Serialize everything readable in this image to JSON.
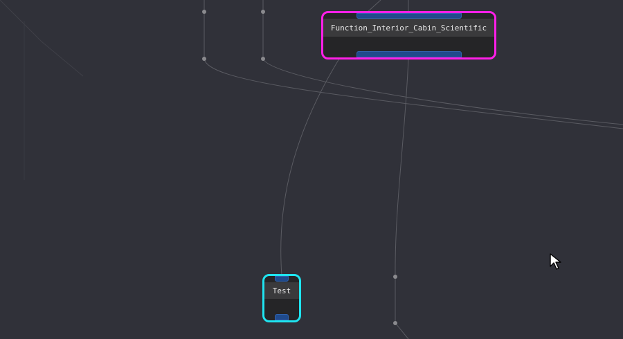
{
  "graph": {
    "nodes": [
      {
        "label": "Function_Interior_Cabin_Scientific",
        "highlight_color": "#ff1fe8"
      },
      {
        "label": "Test",
        "highlight_color": "#1fe4f0"
      }
    ],
    "background_color": "#303139",
    "port_color": "#1f4a8c"
  },
  "cursor": {
    "icon": "arrow-pointer-icon"
  }
}
